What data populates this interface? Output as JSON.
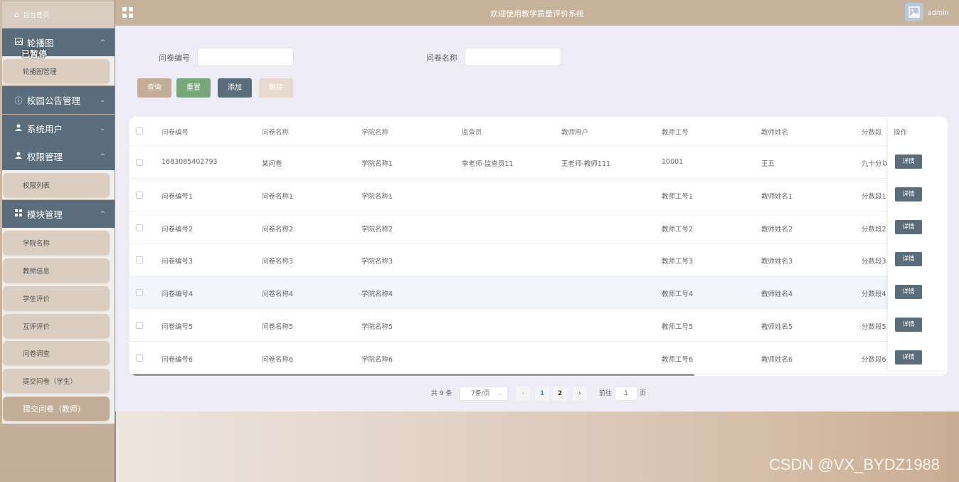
{
  "sidebar": {
    "home": "后台首页",
    "sections": [
      {
        "label": "轮播图",
        "icon": "image-icon",
        "expanded": true,
        "items": [
          "轮播图管理"
        ]
      },
      {
        "label": "校园公告管理",
        "icon": "info-circle-icon",
        "expanded": false,
        "items": []
      },
      {
        "label": "系统用户",
        "icon": "user-icon",
        "expanded": false,
        "items": []
      },
      {
        "label": "权限管理",
        "icon": "user-icon",
        "expanded": true,
        "items": [
          "权限列表"
        ]
      },
      {
        "label": "模块管理",
        "icon": "grid-icon",
        "expanded": true,
        "items": [
          "学院名称",
          "教师信息",
          "学生评价",
          "互评评价",
          "问卷调查",
          "提交问卷（学生）",
          "提交问卷（教师）"
        ]
      }
    ],
    "overlay": "已暂停"
  },
  "header": {
    "title": "欢迎使用教学质量评价系统",
    "user": "admin"
  },
  "search": {
    "field1_label": "问卷编号",
    "field1_value": "",
    "field2_label": "问卷名称",
    "field2_value": ""
  },
  "buttons": {
    "query": "查询",
    "reset": "重置",
    "add": "添加",
    "delete": "删除"
  },
  "colors": {
    "query": "#c3ad98",
    "reset": "#77a67a",
    "add": "#596d7c",
    "delete": "#e7d9cd"
  },
  "table": {
    "columns": [
      "问卷编号",
      "问卷名称",
      "学院名称",
      "监查员",
      "教师用户",
      "教师工号",
      "教师姓名",
      "分数段",
      "操作"
    ],
    "rows": [
      [
        "1683085402793",
        "某问卷",
        "学院名称1",
        "李老师-监查员11",
        "王老师-教师111",
        "10001",
        "王五",
        "九十分以"
      ],
      [
        "问卷编号1",
        "问卷名称1",
        "学院名称1",
        "",
        "",
        "教师工号1",
        "教师姓名1",
        "分数段1"
      ],
      [
        "问卷编号2",
        "问卷名称2",
        "学院名称2",
        "",
        "",
        "教师工号2",
        "教师姓名2",
        "分数段2"
      ],
      [
        "问卷编号3",
        "问卷名称3",
        "学院名称3",
        "",
        "",
        "教师工号3",
        "教师姓名3",
        "分数段3"
      ],
      [
        "问卷编号4",
        "问卷名称4",
        "学院名称4",
        "",
        "",
        "教师工号4",
        "教师姓名4",
        "分数段4"
      ],
      [
        "问卷编号5",
        "问卷名称5",
        "学院名称5",
        "",
        "",
        "教师工号5",
        "教师姓名5",
        "分数段5"
      ],
      [
        "问卷编号6",
        "问卷名称6",
        "学院名称6",
        "",
        "",
        "教师工号6",
        "教师姓名6",
        "分数段6"
      ]
    ],
    "detail_label": "详情"
  },
  "pagination": {
    "total": "共 9 条",
    "page_size": "7条/页",
    "pages": [
      "1",
      "2"
    ],
    "current": "1",
    "goto_label": "前往",
    "goto_value": "1",
    "page_suffix": "页"
  },
  "watermark": "CSDN @VX_BYDZ1988"
}
